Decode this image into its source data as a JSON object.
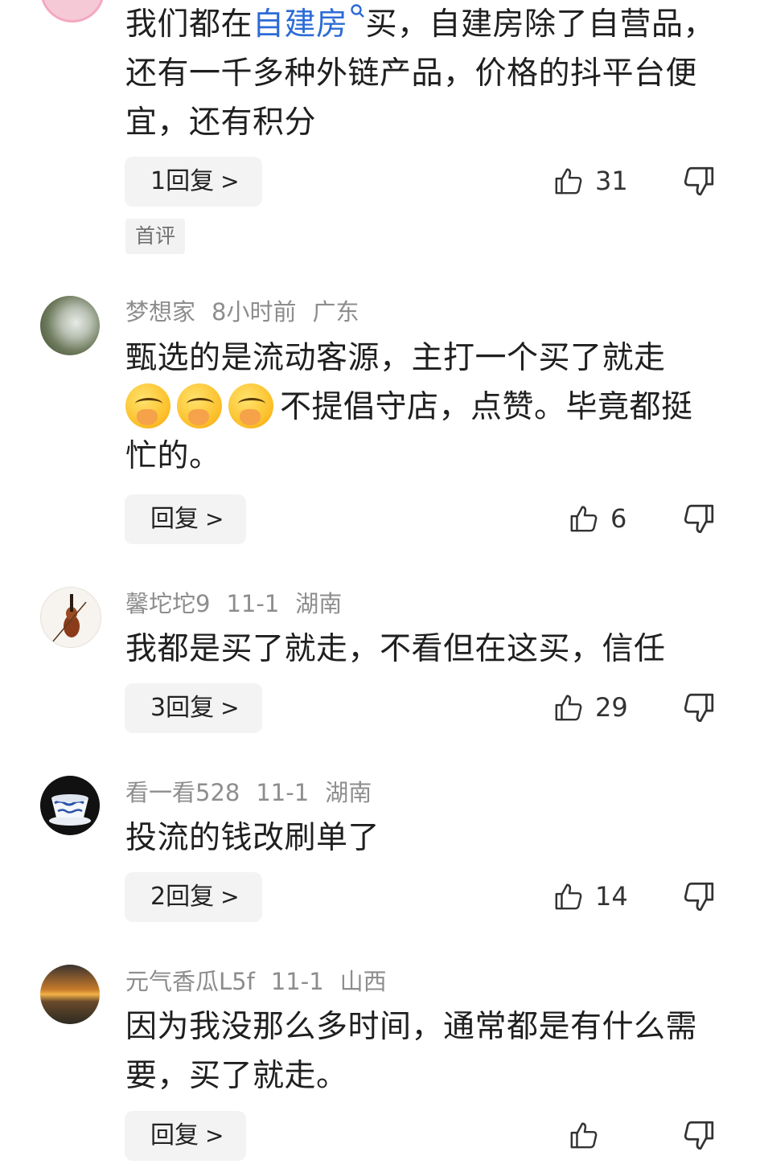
{
  "comments": [
    {
      "text_parts": [
        "我们都在",
        "自建房",
        "买，自建房除了自营品，还有一千多种外链产品，价格的抖平台便宜，还有积分"
      ],
      "reply_label": "1回复",
      "likes": "31",
      "tag": "首评"
    },
    {
      "user": "梦想家",
      "time": "8小时前",
      "location": "广东",
      "text_a": "甄选的是流动客源，主打一个买了就走",
      "text_b": "不提倡守店，点赞。毕竟都挺忙的。",
      "emoji_name": "face-with-hand-over-mouth",
      "reply_label": "回复",
      "likes": "6"
    },
    {
      "user": "馨坨坨9",
      "time": "11-1",
      "location": "湖南",
      "text": "我都是买了就走，不看但在这买，信任",
      "reply_label": "3回复",
      "likes": "29"
    },
    {
      "user": "看一看528",
      "time": "11-1",
      "location": "湖南",
      "text": "投流的钱改刷单了",
      "reply_label": "2回复",
      "likes": "14"
    },
    {
      "user": "元气香瓜L5f",
      "time": "11-1",
      "location": "山西",
      "text": "因为我没那么多时间，通常都是有什么需要，买了就走。",
      "reply_label": "回复",
      "likes": ""
    }
  ],
  "colors": {
    "link": "#2c6bd6",
    "meta": "#8d8d8d",
    "reply_bg": "#f3f3f4"
  }
}
